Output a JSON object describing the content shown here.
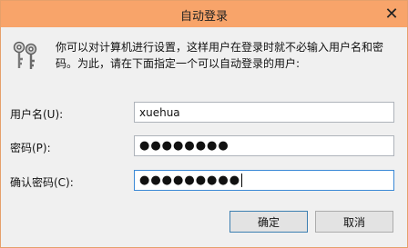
{
  "window": {
    "title": "自动登录",
    "close_glyph": "✕",
    "titlebar_color": "#f8a46a"
  },
  "description": "你可以对计算机进行设置，这样用户在登录时就不必输入用户名和密码。为此，请在下面指定一个可以自动登录的用户:",
  "form": {
    "username": {
      "label": "用户名(U):",
      "value": "xuehua"
    },
    "password": {
      "label": "密码(P):",
      "masked_value": "●●●●●●●●"
    },
    "confirm_password": {
      "label": "确认密码(C):",
      "masked_value": "●●●●●●●●●"
    }
  },
  "buttons": {
    "ok": "确定",
    "cancel": "取消"
  },
  "icons": {
    "dialog_icon": "keys-icon"
  }
}
